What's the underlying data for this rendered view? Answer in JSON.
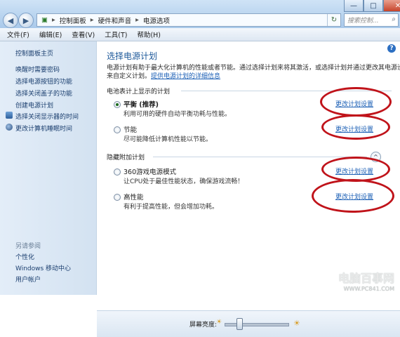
{
  "window": {
    "minimize": "—",
    "maximize": "□",
    "close": "✕"
  },
  "address": {
    "crumbs": [
      "控制面板",
      "硬件和声音",
      "电源选项"
    ],
    "separator": "▸",
    "search_placeholder": "搜索控制..."
  },
  "menu": [
    "文件(F)",
    "编辑(E)",
    "查看(V)",
    "工具(T)",
    "帮助(H)"
  ],
  "sidebar": {
    "home": "控制面板主页",
    "items": [
      "唤醒时需要密码",
      "选择电源按钮的功能",
      "选择关闭盖子的功能",
      "创建电源计划",
      "选择关闭显示器的时间",
      "更改计算机睡眠时间"
    ],
    "see_also_title": "另请参阅",
    "see_also": [
      "个性化",
      "Windows 移动中心",
      "用户帐户"
    ]
  },
  "main": {
    "title": "选择电源计划",
    "intro_line1": "电源计划有助于最大化计算机的性能或者节能。通过选择计划来将其激活，或选择计划并通过更改其电源设置",
    "intro_line2_prefix": "来自定义计划。",
    "intro_link": "提供电源计划的详细信息",
    "battery_group": "电池表计上显示的计划",
    "hidden_group": "隐藏附加计划",
    "plans": [
      {
        "name": "平衡 (推荐)",
        "desc": "利用可用的硬件自动平衡功耗与性能。",
        "link": "更改计划设置",
        "selected": true
      },
      {
        "name": "节能",
        "desc": "尽可能降低计算机性能以节能。",
        "link": "更改计划设置",
        "selected": false
      },
      {
        "name": "360游戏电源模式",
        "desc": "让CPU处于最佳性能状态，确保游戏流畅！",
        "link": "更改计划设置",
        "selected": false
      },
      {
        "name": "高性能",
        "desc": "有利于提高性能，但会增加功耗。",
        "link": "更改计划设置",
        "selected": false
      }
    ],
    "collapse_icon": "^"
  },
  "brightness": {
    "label": "屏幕亮度:",
    "level": 0.22
  },
  "watermark": {
    "text": "电脑百事网",
    "sub": "WWW.PC841.COM"
  },
  "colors": {
    "annotation_red": "#c0131a",
    "link_blue": "#1b5fb5",
    "title_blue": "#1b5799"
  }
}
